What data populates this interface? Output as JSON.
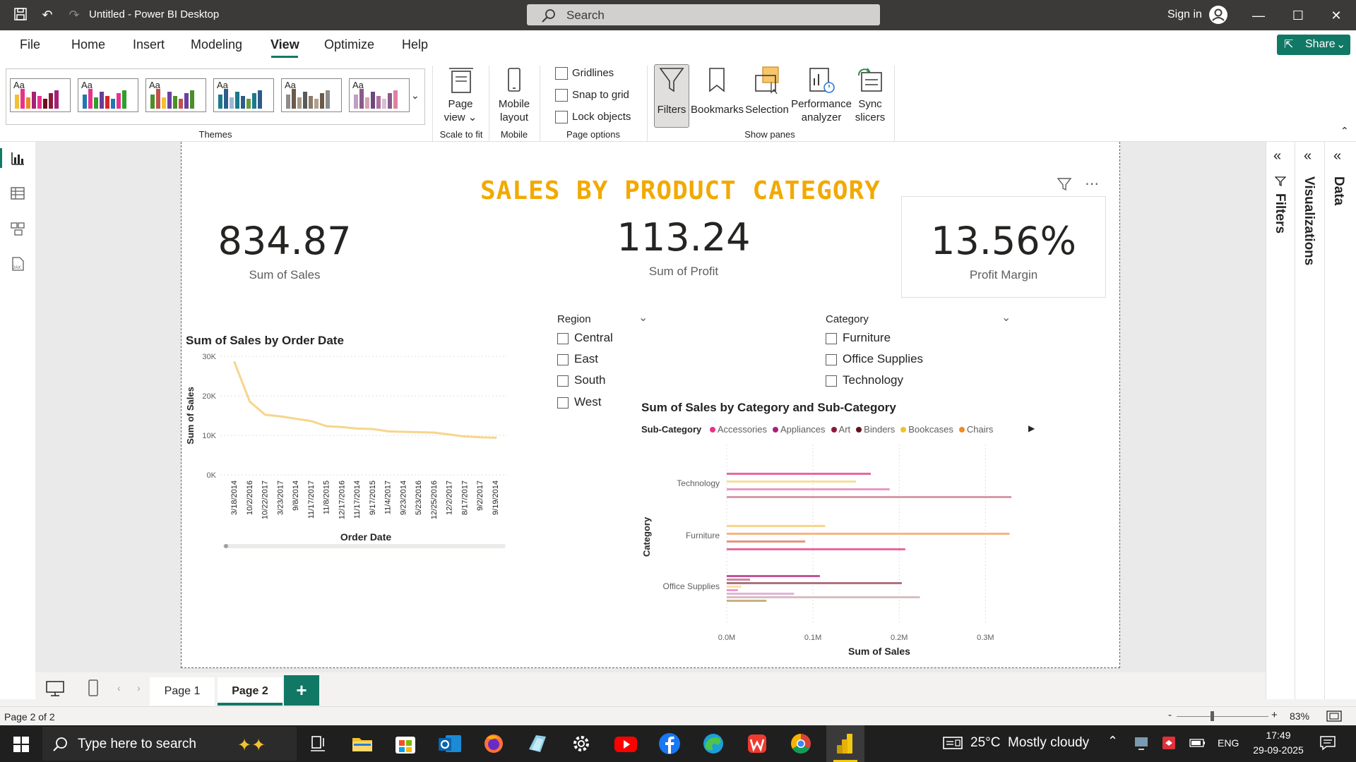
{
  "window": {
    "title": "Untitled - Power BI Desktop",
    "search_placeholder": "Search",
    "sign_in": "Sign in"
  },
  "menu": {
    "items": [
      "File",
      "Home",
      "Insert",
      "Modeling",
      "View",
      "Optimize",
      "Help"
    ],
    "active": "View",
    "share": "Share"
  },
  "ribbon": {
    "themes_label": "Themes",
    "theme_swatch_label": "Aa",
    "page_view": {
      "label_line1": "Page",
      "label_line2": "view",
      "group": "Scale to fit"
    },
    "mobile_layout": {
      "label_line1": "Mobile",
      "label_line2": "layout",
      "group": "Mobile"
    },
    "page_options": {
      "gridlines": "Gridlines",
      "snap": "Snap to grid",
      "lock": "Lock objects",
      "group": "Page options"
    },
    "panes": {
      "filters": "Filters",
      "bookmarks": "Bookmarks",
      "selection": "Selection",
      "performance_line1": "Performance",
      "performance_line2": "analyzer",
      "sync_line1": "Sync",
      "sync_line2": "slicers",
      "group": "Show panes"
    }
  },
  "report": {
    "title": "SALES BY PRODUCT CATEGORY",
    "kpis": {
      "sales": {
        "value": "834.87",
        "label": "Sum of Sales"
      },
      "profit": {
        "value": "113.24",
        "label": "Sum of Profit"
      },
      "margin": {
        "value": "13.56%",
        "label": "Profit Margin"
      }
    },
    "region_slicer": {
      "title": "Region",
      "items": [
        "Central",
        "East",
        "South",
        "West"
      ]
    },
    "category_slicer": {
      "title": "Category",
      "items": [
        "Furniture",
        "Office Supplies",
        "Technology"
      ]
    }
  },
  "chart_data": [
    {
      "type": "line",
      "title": "Sum of Sales by Order Date",
      "xlabel": "Order Date",
      "ylabel": "Sum of Sales",
      "ylim": [
        0,
        30000
      ],
      "yticks": [
        "0K",
        "10K",
        "20K",
        "30K"
      ],
      "categories": [
        "3/18/2014",
        "10/2/2016",
        "10/22/2017",
        "3/23/2017",
        "9/8/2014",
        "11/17/2017",
        "11/8/2015",
        "12/17/2016",
        "11/17/2014",
        "9/17/2015",
        "11/4/2017",
        "9/23/2014",
        "5/23/2016",
        "12/25/2016",
        "12/2/2017",
        "8/17/2017",
        "9/2/2017",
        "9/19/2014"
      ],
      "values": [
        28500,
        18500,
        15200,
        14800,
        14200,
        13600,
        12300,
        12100,
        11700,
        11600,
        11000,
        10900,
        10800,
        10700,
        10200,
        9700,
        9500,
        9400
      ],
      "color": "#f7d58c"
    },
    {
      "type": "bar",
      "orientation": "horizontal",
      "title": "Sum of Sales by Category and Sub-Category",
      "xlabel": "Sum of Sales",
      "ylabel": "Category",
      "legend_title": "Sub-Category",
      "legend": [
        {
          "name": "Accessories",
          "color": "#e8328c"
        },
        {
          "name": "Appliances",
          "color": "#a6207a"
        },
        {
          "name": "Art",
          "color": "#8c1a3a"
        },
        {
          "name": "Binders",
          "color": "#6b0f1a"
        },
        {
          "name": "Bookcases",
          "color": "#f2c12e"
        },
        {
          "name": "Chairs",
          "color": "#f08a24"
        }
      ],
      "xticks": [
        "0.0M",
        "0.1M",
        "0.2M",
        "0.3M"
      ],
      "xlim": [
        0,
        0.33
      ],
      "categories": [
        "Technology",
        "Furniture",
        "Office Supplies"
      ],
      "groups": [
        {
          "category": "Technology",
          "bars": [
            {
              "value": 0.167,
              "color": "#e8679f"
            },
            {
              "value": 0.15,
              "color": "#f3e09a"
            },
            {
              "value": 0.189,
              "color": "#e99ac7"
            },
            {
              "value": 0.33,
              "color": "#d89aa8"
            }
          ]
        },
        {
          "category": "Furniture",
          "bars": [
            {
              "value": 0.114,
              "color": "#f7d58c"
            },
            {
              "value": 0.328,
              "color": "#f5b582"
            },
            {
              "value": 0.091,
              "color": "#e6957f"
            },
            {
              "value": 0.207,
              "color": "#e8679f"
            }
          ]
        },
        {
          "category": "Office Supplies",
          "bars": [
            {
              "value": 0.108,
              "color": "#c4529c"
            },
            {
              "value": 0.027,
              "color": "#c88aa0"
            },
            {
              "value": 0.203,
              "color": "#b0707c"
            },
            {
              "value": 0.017,
              "color": "#f7e2a6"
            },
            {
              "value": 0.013,
              "color": "#ee9ad0"
            },
            {
              "value": 0.078,
              "color": "#e0b4d8"
            },
            {
              "value": 0.224,
              "color": "#d8bfc0"
            },
            {
              "value": 0.046,
              "color": "#c8b080"
            }
          ]
        }
      ]
    }
  ],
  "panes": {
    "filters": "Filters",
    "visualizations": "Visualizations",
    "data": "Data"
  },
  "pages": {
    "tabs": [
      "Page 1",
      "Page 2"
    ],
    "active": "Page 2",
    "add": "+"
  },
  "status": {
    "page_info": "Page 2 of 2",
    "zoom": "83%",
    "zoom_minus": "-",
    "zoom_plus": "+"
  },
  "taskbar": {
    "search_placeholder": "Type here to search",
    "weather": "25°C  Mostly cloudy",
    "language": "ENG",
    "time": "17:49",
    "date": "29-09-2025"
  }
}
